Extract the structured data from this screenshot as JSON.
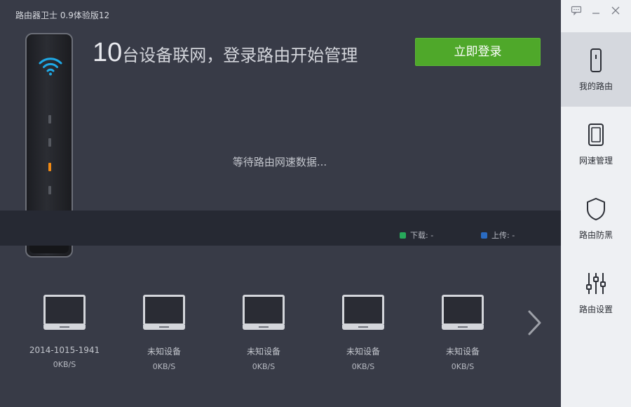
{
  "app": {
    "title": "路由器卫士 0.9体验版12"
  },
  "window_controls": {
    "feedback": "feedback-icon",
    "minimize": "minimize-icon",
    "close": "close-icon"
  },
  "headline": {
    "count": "10",
    "text": "台设备联网，登录路由开始管理"
  },
  "login_button": {
    "label": "立即登录",
    "color": "#4fa82a"
  },
  "status": {
    "waiting": "等待路由网速数据..."
  },
  "speed": {
    "download": {
      "label": "下载: -",
      "color": "#27a85a"
    },
    "upload": {
      "label": "上传: -",
      "color": "#2a6bc2"
    }
  },
  "devices": [
    {
      "name": "2014-1015-1941",
      "speed": "0KB/S"
    },
    {
      "name": "未知设备",
      "speed": "0KB/S"
    },
    {
      "name": "未知设备",
      "speed": "0KB/S"
    },
    {
      "name": "未知设备",
      "speed": "0KB/S"
    },
    {
      "name": "未知设备",
      "speed": "0KB/S"
    }
  ],
  "sidebar": {
    "items": [
      {
        "label": "我的路由",
        "icon": "router-icon",
        "active": true
      },
      {
        "label": "网速管理",
        "icon": "speed-panel-icon",
        "active": false
      },
      {
        "label": "路由防黑",
        "icon": "shield-icon",
        "active": false
      },
      {
        "label": "路由设置",
        "icon": "sliders-icon",
        "active": false
      }
    ]
  }
}
